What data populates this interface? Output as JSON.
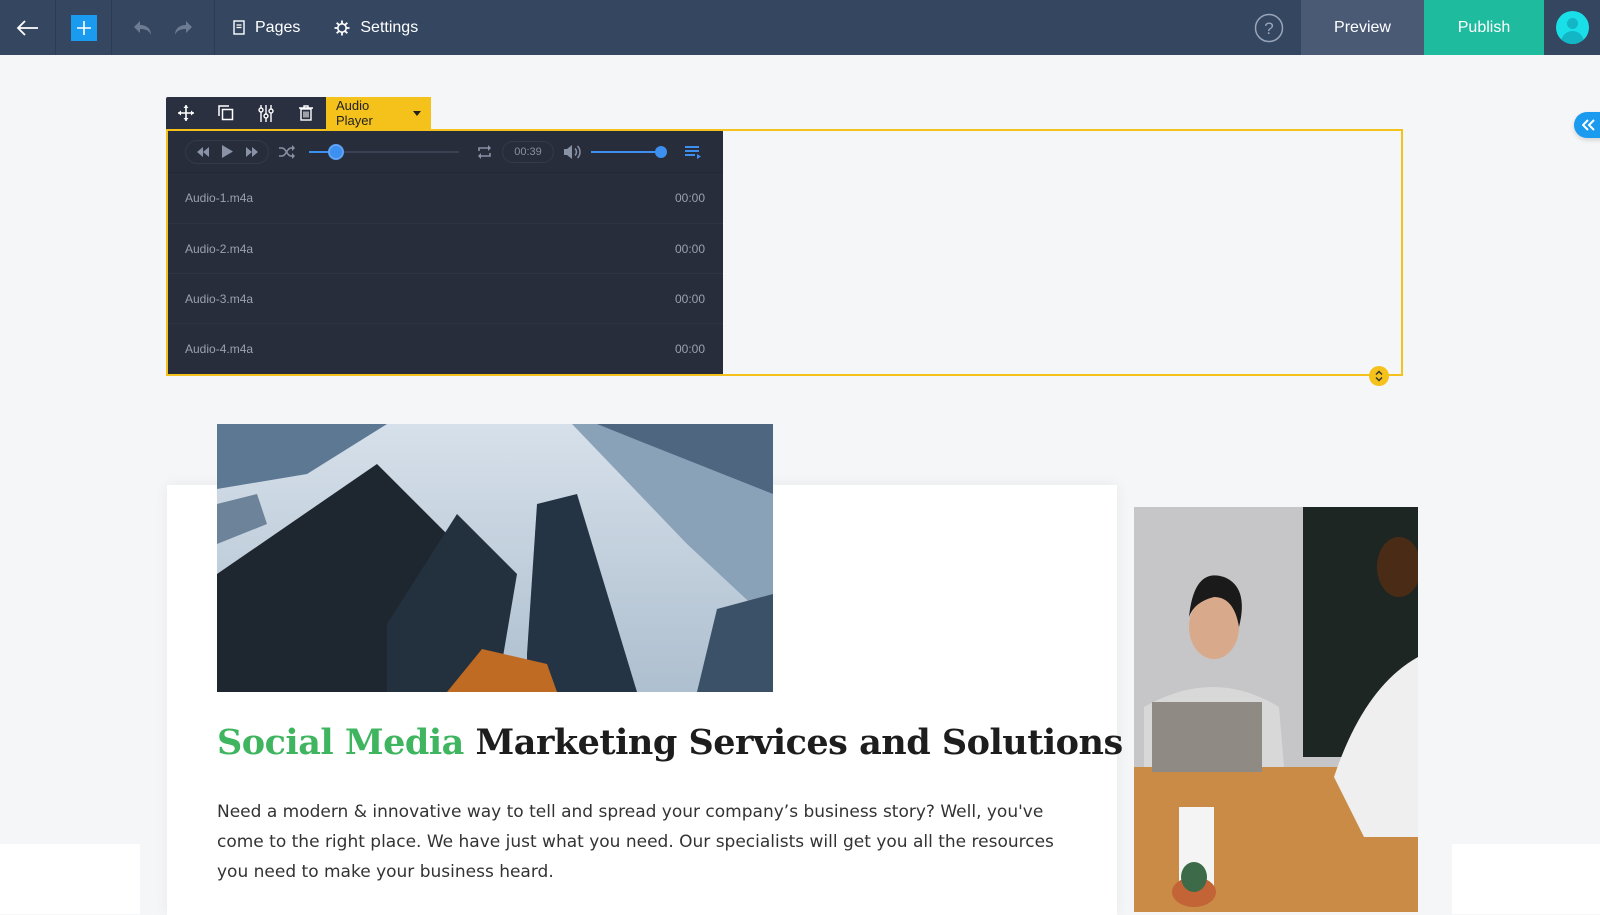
{
  "topbar": {
    "back_icon": "arrow-left-icon",
    "add_icon": "plus-icon",
    "undo_icon": "undo-icon",
    "redo_icon": "redo-icon",
    "nav": [
      {
        "label": "Pages",
        "icon": "page-icon"
      },
      {
        "label": "Settings",
        "icon": "gear-icon"
      }
    ],
    "help_icon": "question-circle-icon",
    "preview_label": "Preview",
    "publish_label": "Publish",
    "avatar_icon": "user-avatar-icon",
    "colors": {
      "bar": "#354661",
      "preview": "#4a5a75",
      "publish": "#1ebb9f",
      "add": "#1a9bf0"
    }
  },
  "element_toolbar": {
    "tools": [
      {
        "name": "move",
        "icon": "move-icon"
      },
      {
        "name": "duplicate",
        "icon": "duplicate-icon"
      },
      {
        "name": "settings",
        "icon": "sliders-icon"
      },
      {
        "name": "delete",
        "icon": "trash-icon"
      }
    ],
    "element_type": "Audio Player",
    "accent": "#f5c21b"
  },
  "audio_player": {
    "progress": 0.18,
    "current_time": "00:39",
    "volume": 1.0,
    "tracks": [
      {
        "name": "Audio-1.m4a",
        "duration": "00:00"
      },
      {
        "name": "Audio-2.m4a",
        "duration": "00:00"
      },
      {
        "name": "Audio-3.m4a",
        "duration": "00:00"
      },
      {
        "name": "Audio-4.m4a",
        "duration": "00:00"
      }
    ],
    "accent": "#3d8ff0"
  },
  "side_panel_toggle_icon": "double-chevron-left-icon",
  "content": {
    "headline_accent": "Social Media",
    "headline_rest": " Marketing Services and Solutions",
    "body": "Need a modern & innovative way to tell and spread your company’s business story? Well, you've come to the right place. We have just what you need. Our specialists will get you all the resources you need to make your business heard.",
    "accent_color": "#3fb560",
    "images": [
      {
        "alt": "Skyscrapers viewed from below"
      },
      {
        "alt": "Two women in a meeting at a wooden table"
      }
    ]
  }
}
